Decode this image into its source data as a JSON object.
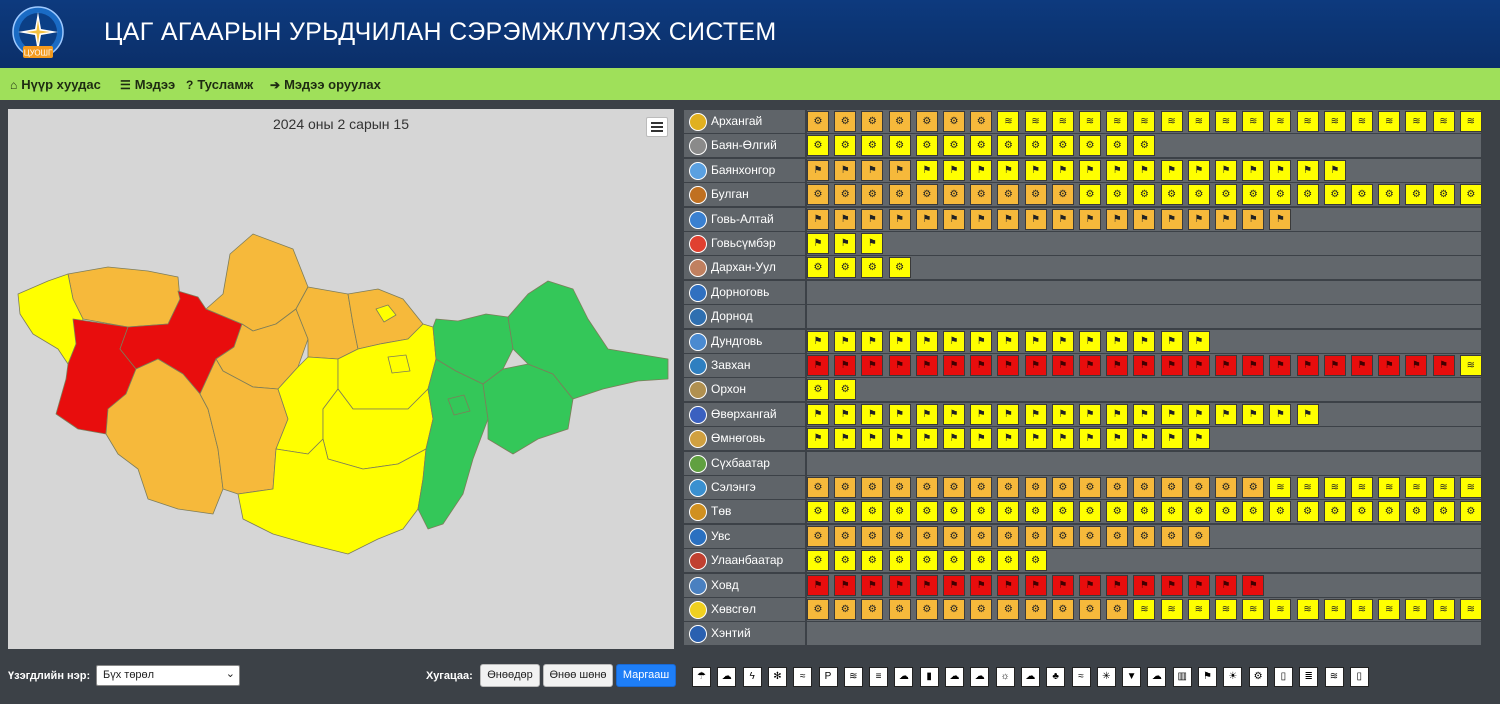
{
  "header": {
    "title": "ЦАГ АГААРЫН УРЬДЧИЛАН СЭРЭМЖЛҮҮЛЭХ СИСТЕМ",
    "logo_icon": "compass-star-emblem",
    "logo_text": "ЦУОШГ"
  },
  "nav": [
    {
      "icon": "home-icon",
      "glyph": "⌂",
      "label": "Нүүр хуудас"
    },
    {
      "icon": "list-icon",
      "glyph": "☰",
      "label": "Мэдээ"
    },
    {
      "icon": "question-circle-icon",
      "glyph": "?",
      "label": "Тусламж"
    },
    {
      "icon": "sign-in-icon",
      "glyph": "➔",
      "label": "Мэдээ оруулах"
    }
  ],
  "map": {
    "title": "2024 оны 2 сарын 15",
    "menu_icon": "hamburger-menu-icon"
  },
  "controls": {
    "phenomenon_label": "Үзэгдлийн нэр:",
    "phenomenon_value": "Бүх төрөл",
    "period_label": "Хугацаа:",
    "buttons": [
      "Өнөөдөр",
      "Өнөө шөнө",
      "Маргааш"
    ],
    "active_button": "Маргааш"
  },
  "colors": {
    "orange": "#f6b93b",
    "yellow": "#ffff00",
    "red": "#e80d0d",
    "green": "#34c759",
    "nav_green": "#9fe05a",
    "header_blue": "#0d3a7e",
    "active_blue": "#1e7ef7"
  },
  "cell_icons": {
    "dust": "dust-storm-icon",
    "wind": "windsock-icon",
    "snow": "blowing-snow-icon"
  },
  "aimags": [
    {
      "name": "Архангай",
      "cells": [
        [
          "o",
          "dust",
          7
        ],
        [
          "y",
          "snow",
          18
        ]
      ]
    },
    {
      "name": "Баян-Өлгий",
      "cells": [
        [
          "y",
          "dust",
          13
        ]
      ]
    },
    {
      "name": "Баянхонгор",
      "cells": [
        [
          "o",
          "wind",
          4
        ],
        [
          "y",
          "wind",
          16
        ]
      ]
    },
    {
      "name": "Булган",
      "cells": [
        [
          "o",
          "dust",
          10
        ],
        [
          "y",
          "dust",
          15
        ]
      ]
    },
    {
      "name": "Говь-Алтай",
      "cells": [
        [
          "o",
          "wind",
          18
        ]
      ]
    },
    {
      "name": "Говьсүмбэр",
      "cells": [
        [
          "y",
          "wind",
          3
        ]
      ]
    },
    {
      "name": "Дархан-Уул",
      "cells": [
        [
          "y",
          "dust",
          4
        ]
      ]
    },
    {
      "name": "Дорноговь",
      "cells": []
    },
    {
      "name": "Дорнод",
      "cells": []
    },
    {
      "name": "Дундговь",
      "cells": [
        [
          "y",
          "wind",
          15
        ]
      ]
    },
    {
      "name": "Завхан",
      "cells": [
        [
          "r",
          "wind",
          24
        ],
        [
          "y",
          "snow",
          1
        ]
      ]
    },
    {
      "name": "Орхон",
      "cells": [
        [
          "y",
          "dust",
          2
        ]
      ]
    },
    {
      "name": "Өвөрхангай",
      "cells": [
        [
          "y",
          "wind",
          19
        ]
      ]
    },
    {
      "name": "Өмнөговь",
      "cells": [
        [
          "y",
          "wind",
          15
        ]
      ]
    },
    {
      "name": "Сүхбаатар",
      "cells": []
    },
    {
      "name": "Сэлэнгэ",
      "cells": [
        [
          "o",
          "dust",
          17
        ],
        [
          "y",
          "snow",
          8
        ]
      ]
    },
    {
      "name": "Төв",
      "cells": [
        [
          "y",
          "dust",
          25
        ]
      ]
    },
    {
      "name": "Увс",
      "cells": [
        [
          "o",
          "dust",
          15
        ]
      ]
    },
    {
      "name": "Улаанбаатар",
      "cells": [
        [
          "y",
          "dust",
          9
        ]
      ]
    },
    {
      "name": "Ховд",
      "cells": [
        [
          "r",
          "wind",
          17
        ]
      ]
    },
    {
      "name": "Хөвсгөл",
      "cells": [
        [
          "o",
          "dust",
          12
        ],
        [
          "y",
          "snow",
          13
        ]
      ]
    },
    {
      "name": "Хэнтий",
      "cells": []
    }
  ],
  "legend": [
    {
      "icon": "rain-cloud-icon",
      "glyph": "☂"
    },
    {
      "icon": "hail-icon",
      "glyph": "☁"
    },
    {
      "icon": "lightning-icon",
      "glyph": "ϟ"
    },
    {
      "icon": "snowflake-icon",
      "glyph": "✻"
    },
    {
      "icon": "blowing-snow-icon",
      "glyph": "≈"
    },
    {
      "icon": "parking-sign-icon",
      "glyph": "P"
    },
    {
      "icon": "snow-storm-icon",
      "glyph": "≋"
    },
    {
      "icon": "fog-icon",
      "glyph": "≡"
    },
    {
      "icon": "sleet-icon",
      "glyph": "☁"
    },
    {
      "icon": "thermometer-low-icon",
      "glyph": "▮"
    },
    {
      "icon": "cloud-snow-icon",
      "glyph": "☁"
    },
    {
      "icon": "frost-cloud-icon",
      "glyph": "☁"
    },
    {
      "icon": "sun-heat-icon",
      "glyph": "☼"
    },
    {
      "icon": "ice-cloud-icon",
      "glyph": "☁"
    },
    {
      "icon": "wildfire-icon",
      "glyph": "♣"
    },
    {
      "icon": "flood-icon",
      "glyph": "≈"
    },
    {
      "icon": "cold-wave-icon",
      "glyph": "✳"
    },
    {
      "icon": "tornado-icon",
      "glyph": "▼"
    },
    {
      "icon": "dust-cloud-icon",
      "glyph": "☁"
    },
    {
      "icon": "rain-gauge-icon",
      "glyph": "▥"
    },
    {
      "icon": "windsock-icon",
      "glyph": "⚑"
    },
    {
      "icon": "thermometer-sun-icon",
      "glyph": "☀"
    },
    {
      "icon": "dust-storm-icon",
      "glyph": "⚙"
    },
    {
      "icon": "thermometer-high-icon",
      "glyph": "▯"
    },
    {
      "icon": "heat-wave-icon",
      "glyph": "≣"
    },
    {
      "icon": "ice-road-icon",
      "glyph": "≋"
    },
    {
      "icon": "thermometer-cold-icon",
      "glyph": "▯"
    }
  ]
}
